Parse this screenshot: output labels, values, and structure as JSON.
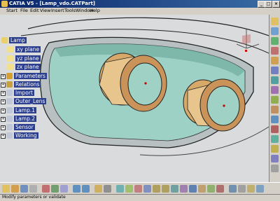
{
  "window": {
    "title": "CATIA V5 - [Lamp_vdo.CATPart]"
  },
  "menu": [
    "Start",
    "File",
    "Edit",
    "View",
    "Insert",
    "Tools",
    "Window",
    "Help"
  ],
  "tree": {
    "root": "Lamp",
    "items": [
      {
        "label": "xy plane",
        "icon": "plane-icon"
      },
      {
        "label": "yz plane",
        "icon": "plane-icon"
      },
      {
        "label": "zx plane",
        "icon": "plane-icon"
      },
      {
        "label": "Parameters",
        "icon": "parameters-icon"
      },
      {
        "label": "Relations",
        "icon": "relations-icon"
      },
      {
        "label": "Import",
        "icon": "import-icon"
      },
      {
        "label": "Outer_Lens",
        "icon": "geometrical-set-icon"
      },
      {
        "label": "Lamp.1",
        "icon": "geometrical-set-icon"
      },
      {
        "label": "Lamp.2",
        "icon": "geometrical-set-icon"
      },
      {
        "label": "Sensor",
        "icon": "geometrical-set-icon"
      },
      {
        "label": "Working",
        "icon": "geometrical-set-icon"
      }
    ]
  },
  "status": {
    "text": "Modify parameters or validate"
  },
  "colors": {
    "tree_highlight": "#2b3f8e",
    "lens": "#9ed1c6",
    "bezel": "#e0b878",
    "body": "#d8dadc"
  }
}
